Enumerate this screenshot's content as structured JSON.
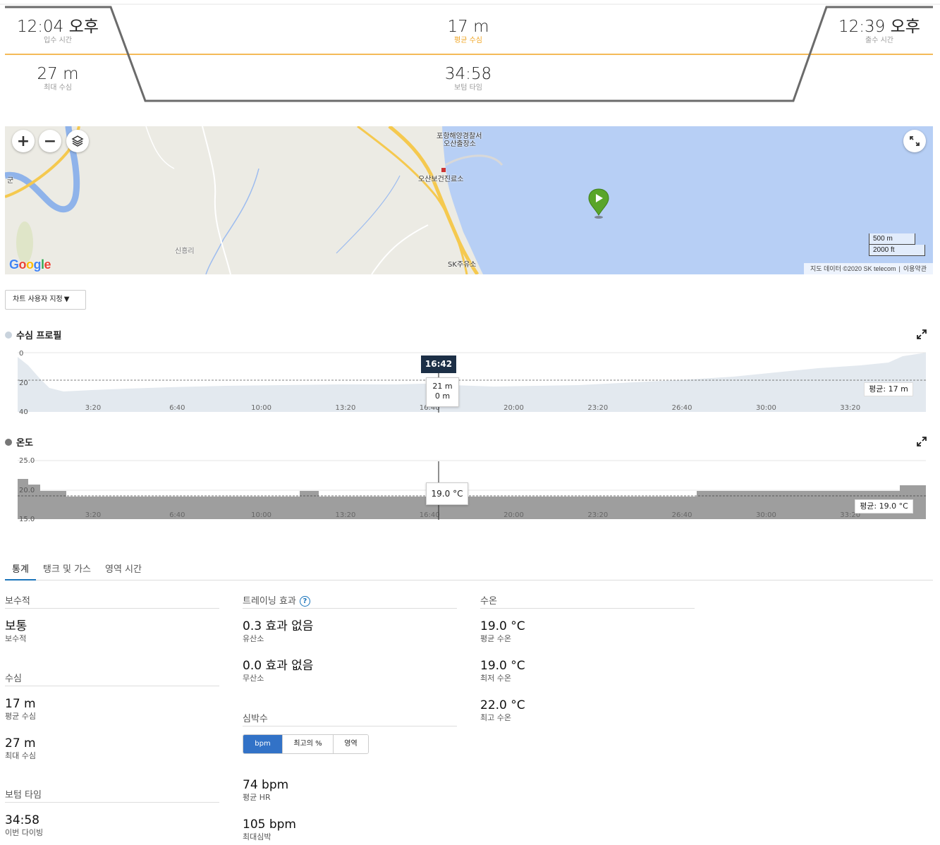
{
  "summary": {
    "entry_time": {
      "value": "12:04 오후",
      "label": "입수 시간"
    },
    "avg_depth": {
      "value": "17 m",
      "label": "평균 수심"
    },
    "exit_time": {
      "value": "12:39 오후",
      "label": "출수 시간"
    },
    "max_depth": {
      "value": "27 m",
      "label": "최대 수심"
    },
    "bottom_time": {
      "value": "34:58",
      "label": "보텀 타임"
    },
    "accent_color": "#f0a420"
  },
  "map": {
    "labels": {
      "police": "포항해양경찰서",
      "police2": "오산출장소",
      "clinic": "오산보건진료소",
      "village": "신흥리",
      "gas": "SK주유소",
      "edge": "군"
    },
    "logo": "Google",
    "scale_metric": "500 m",
    "scale_imperial": "2000 ft",
    "attribution": "지도 데이터 ©2020 SK telecom",
    "terms": "이용약관",
    "water_color": "#b7cff5"
  },
  "chart_customize": "차트 사용자 지정",
  "depth_chart": {
    "title": "수심 프로필",
    "dot_color": "#c9d3dd",
    "fill_color": "#e3e9ef",
    "y_ticks": [
      "0",
      "20",
      "40"
    ],
    "x_ticks": [
      "3:20",
      "6:40",
      "10:00",
      "13:20",
      "16:40",
      "20:00",
      "23:20",
      "26:40",
      "30:00",
      "33:20"
    ],
    "cursor_time": "16:42",
    "tooltip_depth": "21 m",
    "tooltip_second": "0 m",
    "avg_label": "평균: 17 m"
  },
  "temp_chart": {
    "title": "온도",
    "dot_color": "#777777",
    "fill_color": "#9e9e9e",
    "y_ticks": [
      "25.0",
      "20.0",
      "15.0"
    ],
    "x_ticks": [
      "3:20",
      "6:40",
      "10:00",
      "13:20",
      "16:40",
      "20:00",
      "23:20",
      "26:40",
      "30:00",
      "33:20"
    ],
    "tooltip": "19.0 °C",
    "avg_label": "평균: 19.0 °C"
  },
  "tabs": [
    "통계",
    "탱크 및 가스",
    "영역 시간"
  ],
  "stats": {
    "conservatism": {
      "title": "보수적",
      "value": "보통",
      "label": "보수적"
    },
    "depth": {
      "title": "수심",
      "avg_value": "17 m",
      "avg_label": "평균 수심",
      "max_value": "27 m",
      "max_label": "최대 수심"
    },
    "bottom": {
      "title": "보텀 타임",
      "value": "34:58",
      "label": "이번 다이빙"
    },
    "training": {
      "title": "트레이닝 효과",
      "help": "?",
      "aerobic_value": "0.3 효과 없음",
      "aerobic_label": "유산소",
      "anaerobic_value": "0.0 효과 없음",
      "anaerobic_label": "무산소"
    },
    "hr": {
      "title": "심박수",
      "seg": [
        "bpm",
        "최고의 %",
        "영역"
      ],
      "avg_value": "74 bpm",
      "avg_label": "평균 HR",
      "max_value": "105 bpm",
      "max_label": "최대심박"
    },
    "water": {
      "title": "수온",
      "avg_value": "19.0 °C",
      "avg_label": "평균 수온",
      "min_value": "19.0 °C",
      "min_label": "최저 수온",
      "max_value": "22.0 °C",
      "max_label": "최고 수온"
    }
  }
}
